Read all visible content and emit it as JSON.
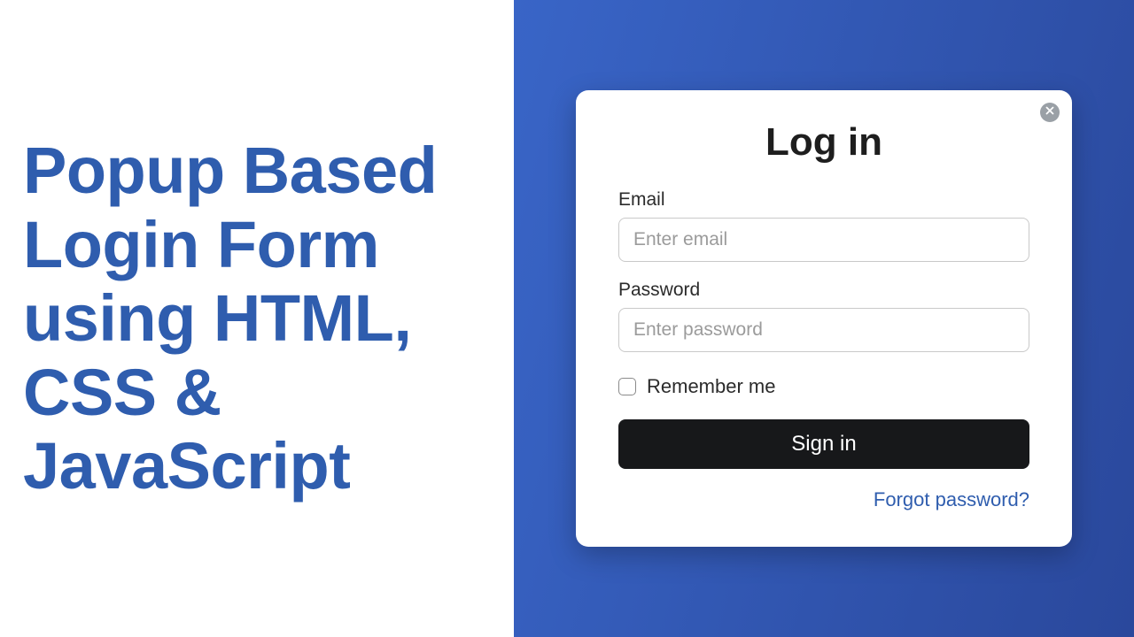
{
  "left": {
    "headline": "Popup Based Login Form using HTML, CSS & JavaScript"
  },
  "login": {
    "title": "Log in",
    "email_label": "Email",
    "email_placeholder": "Enter email",
    "email_value": "",
    "password_label": "Password",
    "password_placeholder": "Enter password",
    "password_value": "",
    "remember_label": "Remember me",
    "signin_label": "Sign in",
    "forgot_label": "Forgot password?"
  },
  "colors": {
    "brand": "#2f5dae",
    "panel_gradient_start": "#3965c7",
    "panel_gradient_end": "#2a489c",
    "button": "#17181a"
  }
}
